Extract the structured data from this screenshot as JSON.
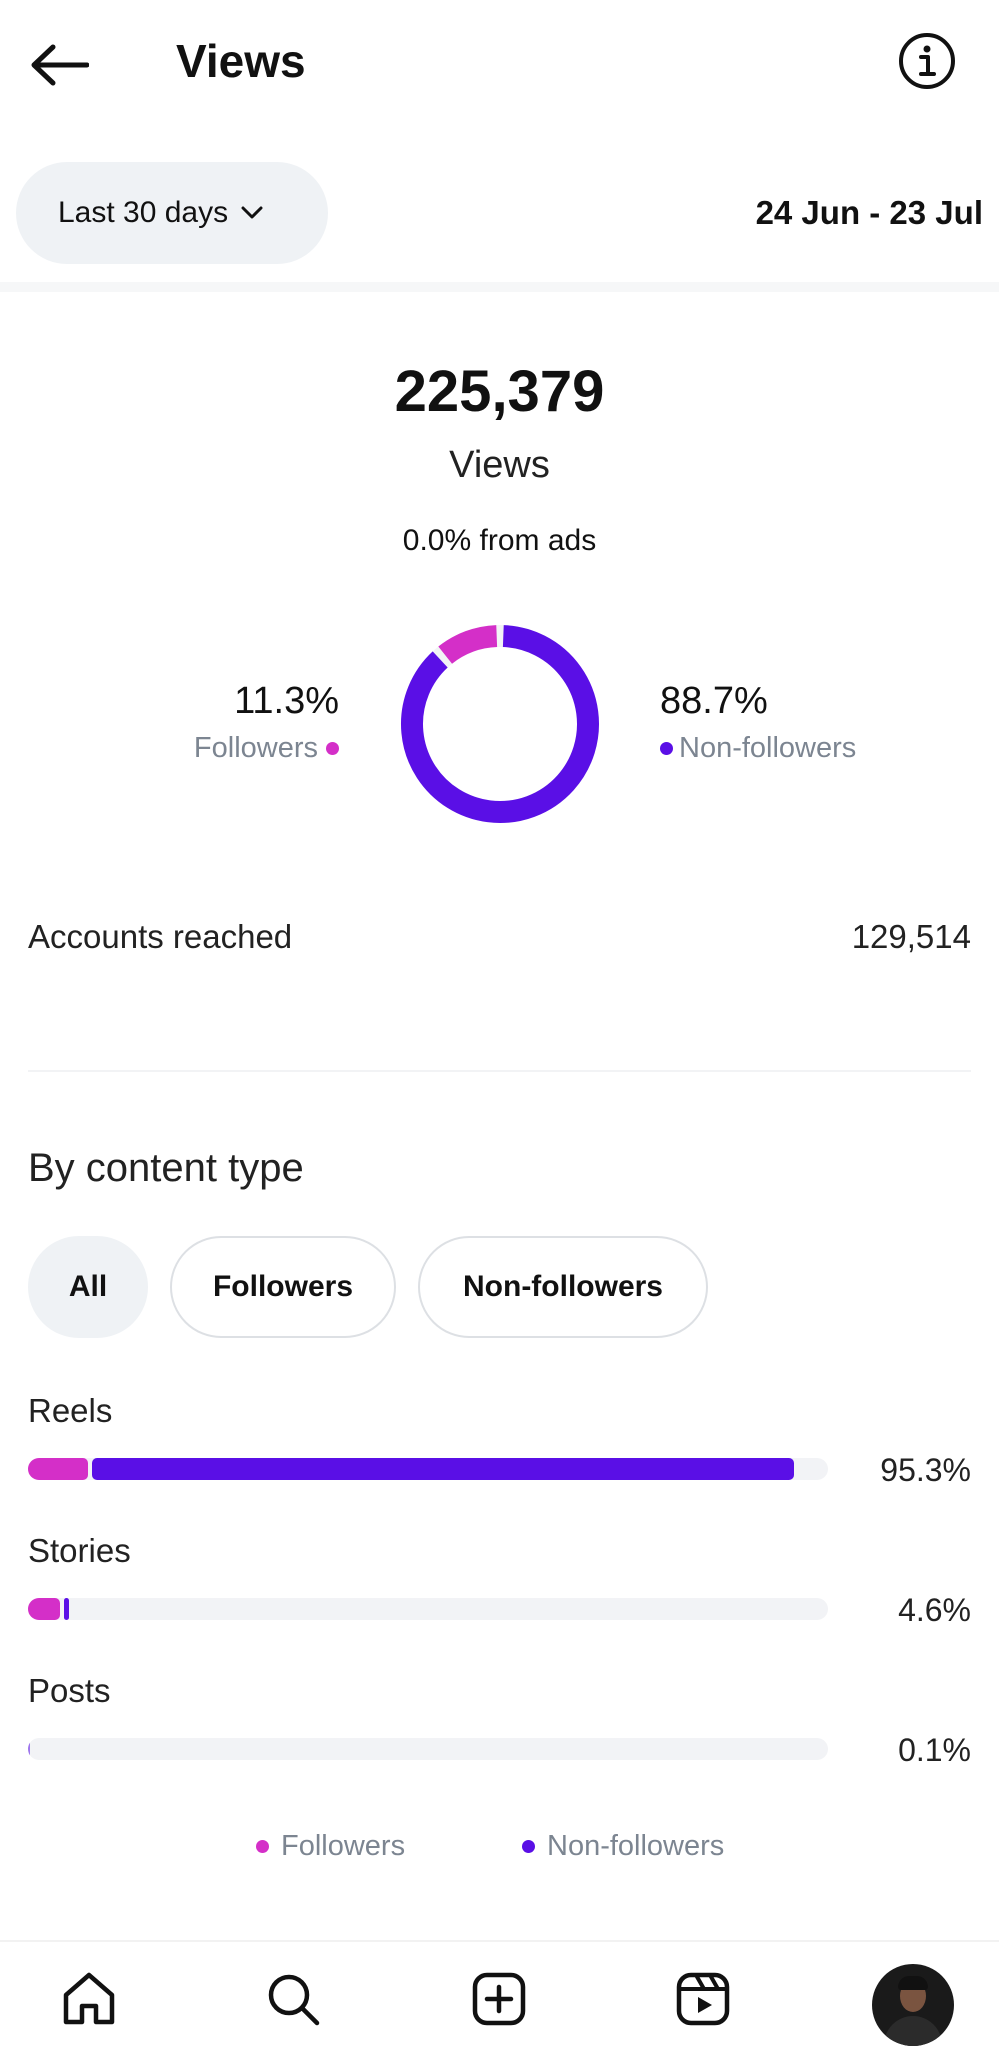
{
  "header": {
    "title": "Views"
  },
  "range": {
    "label": "Last 30 days",
    "dates": "24 Jun - 23 Jul"
  },
  "summary": {
    "total": "225,379",
    "label": "Views",
    "ads": "0.0% from ads",
    "followers_pct": "11.3%",
    "followers_label": "Followers",
    "nonfollowers_pct": "88.7%",
    "nonfollowers_label": "Non-followers"
  },
  "reach": {
    "label": "Accounts reached",
    "value": "129,514"
  },
  "content": {
    "title": "By content type",
    "chips": [
      "All",
      "Followers",
      "Non-followers"
    ],
    "active_chip": "All",
    "rows": [
      {
        "label": "Reels",
        "pct": "95.3%",
        "followers": 7.5,
        "nonfollowers": 87.8
      },
      {
        "label": "Stories",
        "pct": "4.6%",
        "followers": 4.0,
        "nonfollowers": 0.6
      },
      {
        "label": "Posts",
        "pct": "0.1%",
        "followers": 0.0,
        "nonfollowers": 0.1
      }
    ],
    "legend": {
      "followers": "Followers",
      "nonfollowers": "Non-followers"
    }
  },
  "colors": {
    "followers": "#d42fc8",
    "nonfollowers": "#5a0fe6",
    "track": "#f2f3f6",
    "chip_bg": "#eff2f5"
  },
  "icons": {
    "back": "arrow-left-icon",
    "info": "info-icon",
    "dropdown": "chevron-down-icon",
    "nav": [
      "home-icon",
      "search-icon",
      "create-icon",
      "reels-icon",
      "profile-avatar"
    ]
  }
}
